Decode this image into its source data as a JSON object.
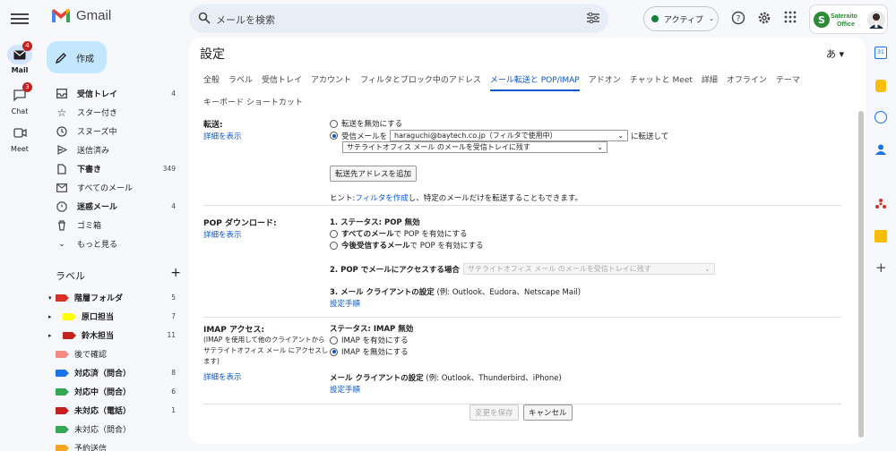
{
  "app": {
    "name": "Gmail"
  },
  "search": {
    "placeholder": "メールを検索"
  },
  "status": {
    "label": "アクティブ"
  },
  "brand": {
    "text": "Sateraito Office"
  },
  "rail": [
    {
      "label": "Mail",
      "badge": "4"
    },
    {
      "label": "Chat",
      "badge": "3"
    },
    {
      "label": "Meet",
      "badge": ""
    }
  ],
  "compose": {
    "label": "作成"
  },
  "folders": [
    {
      "label": "受信トレイ",
      "count": "4",
      "bold": true
    },
    {
      "label": "スター付き",
      "count": ""
    },
    {
      "label": "スヌーズ中",
      "count": ""
    },
    {
      "label": "送信済み",
      "count": ""
    },
    {
      "label": "下書き",
      "count": "349",
      "bold": true
    },
    {
      "label": "すべてのメール",
      "count": ""
    },
    {
      "label": "迷惑メール",
      "count": "4",
      "bold": true
    },
    {
      "label": "ゴミ箱",
      "count": ""
    },
    {
      "label": "もっと見る",
      "count": ""
    }
  ],
  "labels_head": {
    "title": "ラベル",
    "add": "+"
  },
  "labels": [
    {
      "label": "階層フォルダ",
      "count": "5",
      "color": "#d93025",
      "bold": true
    },
    {
      "label": "原口担当",
      "count": "7",
      "color": "#ffff00",
      "bold": true
    },
    {
      "label": "鈴木担当",
      "count": "11",
      "color": "#c5221f",
      "bold": true
    },
    {
      "label": "後で確認",
      "count": "",
      "color": "#f28b82",
      "bold": false
    },
    {
      "label": "対応済（問合）",
      "count": "8",
      "color": "#1a73e8",
      "bold": true
    },
    {
      "label": "対応中（問合）",
      "count": "6",
      "color": "#34a853",
      "bold": true
    },
    {
      "label": "未対応（電話）",
      "count": "1",
      "color": "#c5221f",
      "bold": true
    },
    {
      "label": "未対応（問合）",
      "count": "",
      "color": "#34a853",
      "bold": false
    },
    {
      "label": "予約送信",
      "count": "",
      "color": "#f6a623",
      "bold": false
    }
  ],
  "settings": {
    "title": "設定",
    "lang": "あ ▾",
    "tabs": [
      "全般",
      "ラベル",
      "受信トレイ",
      "アカウント",
      "フィルタとブロック中のアドレス",
      "メール転送と POP/IMAP",
      "アドオン",
      "チャットと Meet",
      "詳細",
      "オフライン",
      "テーマ",
      "キーボード ショートカット"
    ],
    "active_tab": "メール転送と POP/IMAP",
    "forward": {
      "label": "転送:",
      "details": "詳細を表示",
      "opt_disable": "転送を無効にする",
      "opt_enable_prefix": "受信メールを",
      "address": "haraguchi@baytech.co.jp（フィルタで使用中）",
      "suffix": "に転送して",
      "action": "サテライトオフィス メール のメールを受信トレイに残す",
      "add_button": "転送先アドレスを追加",
      "hint_prefix": "ヒント: ",
      "hint_link": "フィルタを作成",
      "hint_suffix": "し、特定のメールだけを転送することもできます。"
    },
    "pop": {
      "label": "POP ダウンロード:",
      "details": "詳細を表示",
      "status": "1. ステータス: POP 無効",
      "opt_all_bold": "すべてのメール",
      "opt_all_rest": "で POP を有効にする",
      "opt_new_bold": "今後受信するメール",
      "opt_new_rest": "で POP を有効にする",
      "access_label": "2. POP でメールにアクセスする場合",
      "access_value": "サテライトオフィス メール のメールを受信トレイに残す",
      "client_label": "3. メール クライアントの設定",
      "client_examples": "(例: Outlook、Eudora、Netscape Mail)",
      "client_link": "設定手順"
    },
    "imap": {
      "label": "IMAP アクセス:",
      "desc": "(IMAP を使用して他のクライアントからサテライトオフィス メール にアクセスします)",
      "details": "詳細を表示",
      "status": "ステータス: IMAP 無効",
      "opt_enable": "IMAP を有効にする",
      "opt_disable": "IMAP を無効にする",
      "client_label": "メール クライアントの設定",
      "client_examples": "(例: Outlook、Thunderbird、iPhone)",
      "client_link": "設定手順"
    },
    "save": "変更を保存",
    "cancel": "キャンセル"
  },
  "colors": {
    "accent": "#0b57d0",
    "compose_bg": "#c2e7ff",
    "status_green": "#188038"
  }
}
